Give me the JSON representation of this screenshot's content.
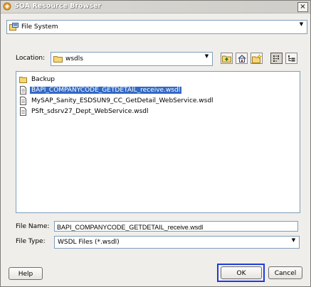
{
  "window": {
    "title": "SOA Resource Browser",
    "close_glyph": "×"
  },
  "source_selector": {
    "value": "File System"
  },
  "location": {
    "label": "Location:",
    "value": "wsdls"
  },
  "toolbar": {
    "buttons": [
      "up-one-level-icon",
      "home-icon",
      "new-folder-icon",
      "list-view-icon",
      "details-view-icon"
    ],
    "active": "list-view-icon"
  },
  "files": [
    {
      "name": "Backup",
      "type": "folder",
      "selected": false
    },
    {
      "name": "BAPI_COMPANYCODE_GETDETAIL_receive.wsdl",
      "type": "file",
      "selected": true
    },
    {
      "name": "MySAP_Sanity_ESDSUN9_CC_GetDetail_WebService.wsdl",
      "type": "file",
      "selected": false
    },
    {
      "name": "PSft_sdsrv27_Dept_WebService.wsdl",
      "type": "file",
      "selected": false
    }
  ],
  "file_name": {
    "label": "File Name:",
    "value": "BAPI_COMPANYCODE_GETDETAIL_receive.wsdl"
  },
  "file_type": {
    "label": "File Type:",
    "value": "WSDL Files (*.wsdl)"
  },
  "buttons": {
    "help": "Help",
    "ok": "OK",
    "cancel": "Cancel"
  },
  "colors": {
    "selection": "#3169c6",
    "focus_ring": "#1e3cd8",
    "dialog_bg": "#f0eeeb"
  }
}
